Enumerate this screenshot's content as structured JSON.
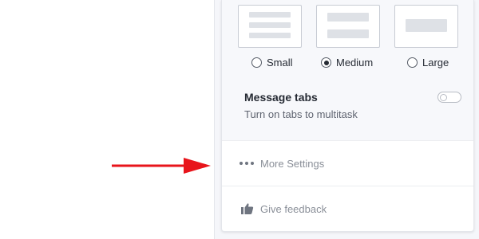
{
  "density": {
    "options": [
      {
        "label": "Small",
        "selected": false
      },
      {
        "label": "Medium",
        "selected": true
      },
      {
        "label": "Large",
        "selected": false
      }
    ]
  },
  "message_tabs": {
    "title": "Message tabs",
    "description": "Turn on tabs to multitask",
    "enabled": false
  },
  "menu": {
    "more_settings_label": "More Settings",
    "give_feedback_label": "Give feedback"
  },
  "icons": {
    "more": "more-dots-icon",
    "feedback": "thumbs-up-icon",
    "annotation": "red-arrow-icon"
  },
  "colors": {
    "arrow": "#e8141b",
    "panel_bg": "#f5f6fa",
    "text": "#252a33",
    "muted": "#8a8f98"
  }
}
